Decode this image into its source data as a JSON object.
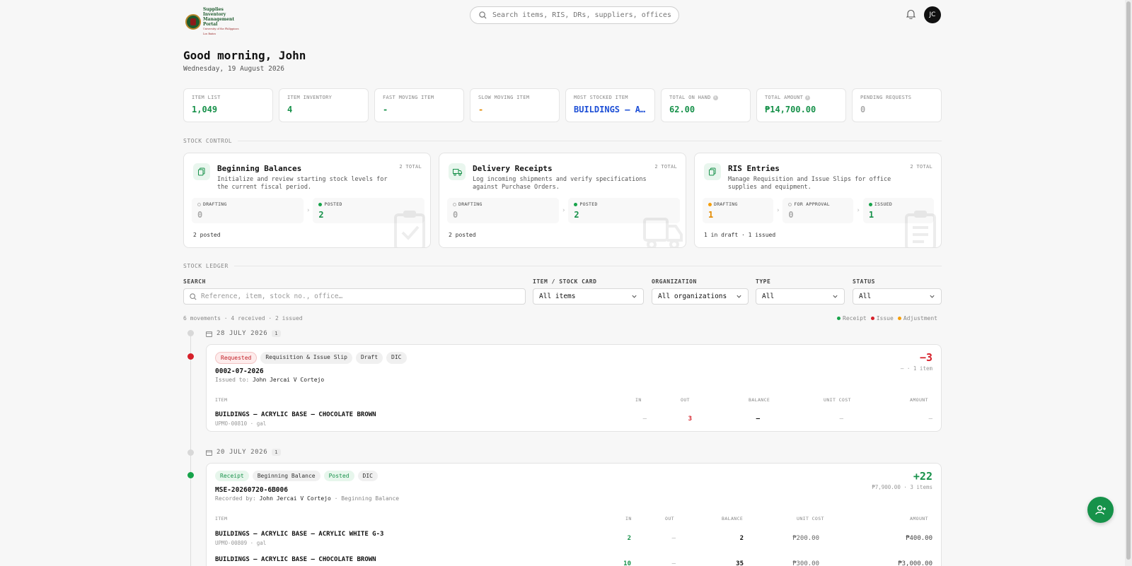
{
  "logo": {
    "title": "Supplies Inventory Management Portal",
    "subtitle": "University of the Philippines Los Baños"
  },
  "search": {
    "placeholder": "Search items, RIS, DRs, suppliers, offices, p"
  },
  "user": {
    "initials": "JC"
  },
  "greeting": "Good morning, John",
  "date": "Wednesday, 19 August 2026",
  "stats": [
    {
      "label": "ITEM LIST",
      "value": "1,049",
      "color": "#17914a"
    },
    {
      "label": "ITEM INVENTORY",
      "value": "4",
      "color": "#17914a"
    },
    {
      "label": "FAST MOVING ITEM",
      "value": "-",
      "color": "#17914a"
    },
    {
      "label": "SLOW MOVING ITEM",
      "value": "-",
      "color": "#e38a00"
    },
    {
      "label": "MOST STOCKED ITEM",
      "value": "BUILDINGS — ACRYLIC BASE — CHOCOLATE BROWN",
      "color": "#1d4fd6"
    },
    {
      "label": "TOTAL ON HAND",
      "value": "62.00",
      "color": "#17914a",
      "info": true
    },
    {
      "label": "TOTAL AMOUNT",
      "value": "₱14,700.00",
      "color": "#17914a",
      "info": true
    },
    {
      "label": "PENDING REQUESTS",
      "value": "0",
      "color": "#aaaaaa"
    }
  ],
  "stock_control": {
    "heading": "STOCK CONTROL",
    "cards": [
      {
        "title": "Beginning Balances",
        "total": "2 TOTAL",
        "description": "Initialize and review starting stock levels for the current fiscal period.",
        "stages": [
          {
            "label": "DRAFTING",
            "value": "0",
            "dot": "ring"
          },
          {
            "label": "POSTED",
            "value": "2",
            "dot": "green"
          }
        ],
        "footer": "2 posted"
      },
      {
        "title": "Delivery Receipts",
        "total": "2 TOTAL",
        "description": "Log incoming shipments and verify specifications against Purchase Orders.",
        "stages": [
          {
            "label": "DRAFTING",
            "value": "0",
            "dot": "ring"
          },
          {
            "label": "POSTED",
            "value": "2",
            "dot": "green"
          }
        ],
        "footer": "2 posted"
      },
      {
        "title": "RIS Entries",
        "total": "2 TOTAL",
        "description": "Manage Requisition and Issue Slips for office supplies and equipment.",
        "stages": [
          {
            "label": "DRAFTING",
            "value": "1",
            "dot": "orange"
          },
          {
            "label": "FOR APPROVAL",
            "value": "0",
            "dot": "ring"
          },
          {
            "label": "ISSUED",
            "value": "1",
            "dot": "green"
          }
        ],
        "footer": "1 in draft · 1 issued"
      }
    ]
  },
  "ledger": {
    "heading": "STOCK LEDGER",
    "filters": {
      "search_label": "SEARCH",
      "search_placeholder": "Reference, item, stock no., office…",
      "item_label": "ITEM / STOCK CARD",
      "item_value": "All items",
      "org_label": "ORGANIZATION",
      "org_value": "All organizations",
      "type_label": "TYPE",
      "type_value": "All",
      "status_label": "STATUS",
      "status_value": "All"
    },
    "summary": "6 movements · 4 received · 2 issued",
    "legend": [
      {
        "label": "Receipt",
        "color": "#17a34a"
      },
      {
        "label": "Issue",
        "color": "#d6202a"
      },
      {
        "label": "Adjustment",
        "color": "#f59e0b"
      }
    ],
    "columns": {
      "item": "ITEM",
      "in": "IN",
      "out": "OUT",
      "balance": "BALANCE",
      "unit_cost": "UNIT COST",
      "amount": "AMOUNT"
    },
    "groups": [
      {
        "date": "28 JULY 2026",
        "count": "1",
        "movement": {
          "chips": [
            "Requested",
            "Requisition & Issue Slip",
            "Draft",
            "DIC"
          ],
          "reference": "0002-07-2026",
          "by_label": "Issued to:",
          "by_name": "John Jercai V Cortejo",
          "quantity": "−3",
          "meta": "— · 1 item",
          "rows": [
            {
              "name": "BUILDINGS — ACRYLIC BASE — CHOCOLATE BROWN",
              "sub": "UPMO-00810 · gal",
              "in": "—",
              "out": "3",
              "balance": "–",
              "unit_cost": "—",
              "amount": "—"
            }
          ]
        }
      },
      {
        "date": "20 JULY 2026",
        "count": "1",
        "movement": {
          "chips": [
            "Receipt",
            "Beginning Balance",
            "Posted",
            "DIC"
          ],
          "reference": "MSE-20260720-6B006",
          "by_label": "Recorded by:",
          "by_name": "John Jercai V Cortejo",
          "by_extra": "· Beginning Balance",
          "quantity": "+22",
          "meta": "₱7,900.00 · 3 items",
          "rows": [
            {
              "name": "BUILDINGS — ACRYLIC BASE — ACRYLIC WHITE G-3",
              "sub": "UPMO-00809 · gal",
              "in": "2",
              "out": "—",
              "balance": "2",
              "unit_cost": "₱200.00",
              "amount": "₱400.00"
            },
            {
              "name": "BUILDINGS — ACRYLIC BASE — CHOCOLATE BROWN",
              "sub": "",
              "in": "10",
              "out": "—",
              "balance": "35",
              "unit_cost": "₱300.00",
              "amount": "₱3,000.00"
            }
          ]
        }
      }
    ]
  },
  "icons": {
    "search": "search-icon",
    "bell": "bell-icon",
    "copy": "documents-icon",
    "truck": "truck-icon",
    "calendar": "calendar-icon",
    "chevron": "chevron-down-icon",
    "fab": "add-user-icon"
  }
}
